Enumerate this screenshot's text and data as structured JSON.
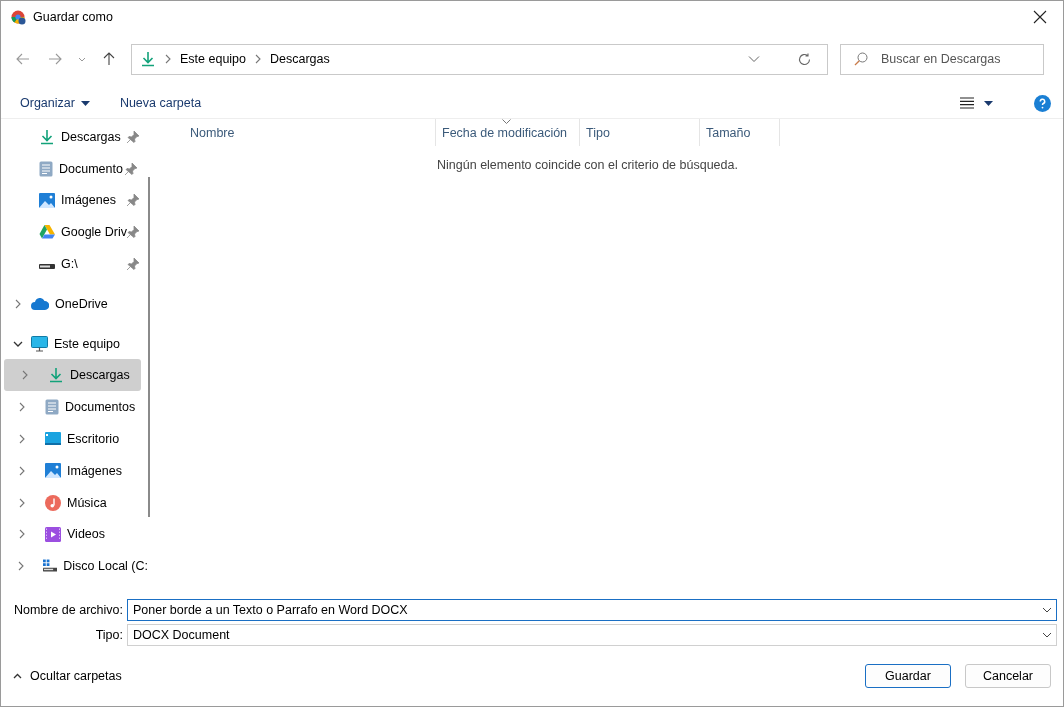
{
  "window": {
    "title": "Guardar como"
  },
  "nav": {
    "path": [
      "Este equipo",
      "Descargas"
    ],
    "search": {
      "placeholder": "Buscar en Descargas"
    }
  },
  "toolbar": {
    "organize": "Organizar",
    "new_folder": "Nueva carpeta"
  },
  "sidebar": {
    "quick_access": [
      {
        "label": "Descargas",
        "kind": "download",
        "pinned": true
      },
      {
        "label": "Documento",
        "kind": "document",
        "pinned": true
      },
      {
        "label": "Imágenes",
        "kind": "picture",
        "pinned": true
      },
      {
        "label": "Google Driv",
        "kind": "gdrive",
        "pinned": true
      },
      {
        "label": "G:\\",
        "kind": "drive",
        "pinned": true
      }
    ],
    "tree": [
      {
        "label": "OneDrive",
        "kind": "cloud",
        "expanded": false,
        "selected": false
      },
      {
        "label": "Este equipo",
        "kind": "computer",
        "expanded": true,
        "selected": false,
        "children": [
          {
            "label": "Descargas",
            "kind": "download",
            "expanded": false,
            "selected": true
          },
          {
            "label": "Documentos",
            "kind": "document",
            "expanded": false,
            "selected": false
          },
          {
            "label": "Escritorio",
            "kind": "desktop",
            "expanded": false,
            "selected": false
          },
          {
            "label": "Imágenes",
            "kind": "picture",
            "expanded": false,
            "selected": false
          },
          {
            "label": "Música",
            "kind": "music",
            "expanded": false,
            "selected": false
          },
          {
            "label": "Videos",
            "kind": "video",
            "expanded": false,
            "selected": false
          },
          {
            "label": "Disco Local (C:",
            "kind": "disk",
            "expanded": false,
            "selected": false
          }
        ]
      }
    ]
  },
  "table": {
    "columns": [
      {
        "label": "Nombre",
        "sorted": false
      },
      {
        "label": "Fecha de modificación",
        "sorted": true
      },
      {
        "label": "Tipo",
        "sorted": false
      },
      {
        "label": "Tamaño",
        "sorted": false
      }
    ],
    "empty_message": "Ningún elemento coincide con el criterio de búsqueda."
  },
  "form": {
    "filename": {
      "label": "Nombre de archivo:",
      "value": "Poner borde a un Texto o Parrafo en Word DOCX"
    },
    "type": {
      "label": "Tipo:",
      "value": "DOCX Document"
    }
  },
  "footer": {
    "hide_folders": "Ocultar carpetas",
    "buttons": [
      {
        "label": "Guardar",
        "kind": "primary"
      },
      {
        "label": "Cancelar",
        "kind": "secondary"
      }
    ]
  }
}
